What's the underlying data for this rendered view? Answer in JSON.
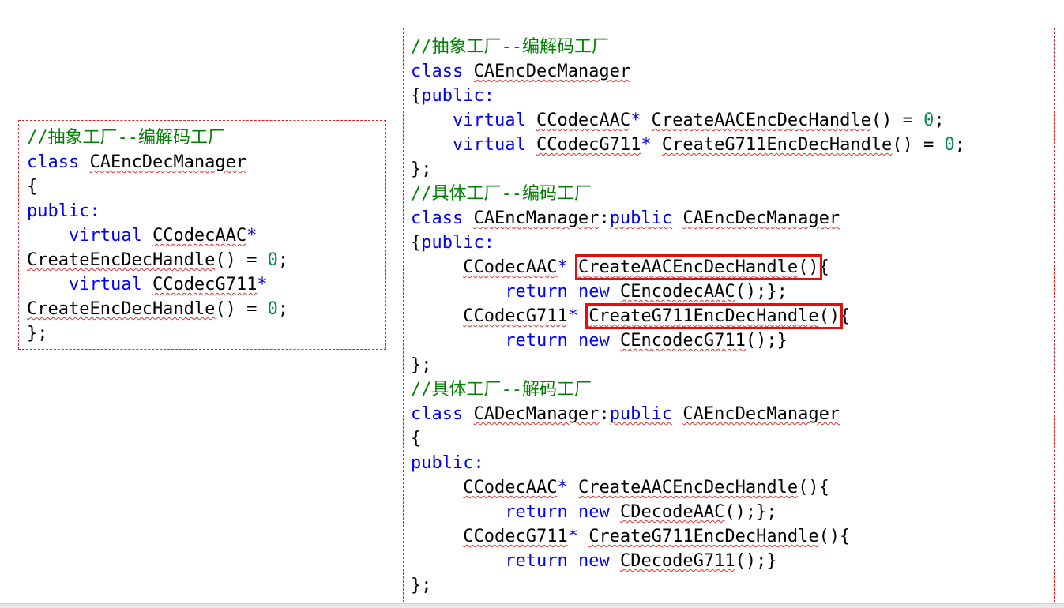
{
  "left": {
    "comment": "//抽象工厂--编解码工厂",
    "class_kw": "class",
    "class_name": "CAEncDecManager",
    "open_brace": "{",
    "public_kw": "public:",
    "virtual_kw": "virtual",
    "aac_type": "CCodecAAC",
    "g711_type": "CCodecG711",
    "star": "*",
    "method": "CreateEncDecHandle",
    "method_tail": "() = ",
    "zero": "0",
    "semicolon": ";",
    "close": "};"
  },
  "right": {
    "comment1": "//抽象工厂--编解码工厂",
    "comment2": "//具体工厂--编码工厂",
    "comment3": "//具体工厂--解码工厂",
    "class_kw": "class",
    "public_kw": "public",
    "public_colon": "public:",
    "brace_public": "{",
    "open_brace": "{",
    "virtual_kw": "virtual",
    "return_kw": "return",
    "new_kw": "new",
    "base_class": "CAEncDecManager",
    "enc_class": "CAEncManager",
    "dec_class": "CADecManager",
    "colon": ":",
    "aac_type": "CCodecAAC",
    "g711_type": "CCodecG711",
    "star": "*",
    "aac_method": "CreateAACEncDecHandle",
    "g711_method": "CreateG711EncDecHandle",
    "pure_tail": "() = ",
    "zero": "0",
    "semicolon": ";",
    "call_brace": "(){",
    "paren_open": "(",
    "paren_close": ")",
    "brace_after": "{",
    "enc_aac_ctor": "CEncodecAAC",
    "enc_g711_ctor": "CEncodecG711",
    "dec_aac_ctor": "CDecodeAAC",
    "dec_g711_ctor": "CDecodeG711",
    "ret_tail_aac": "();};",
    "ret_tail_g711": "();}",
    "close": "};"
  }
}
